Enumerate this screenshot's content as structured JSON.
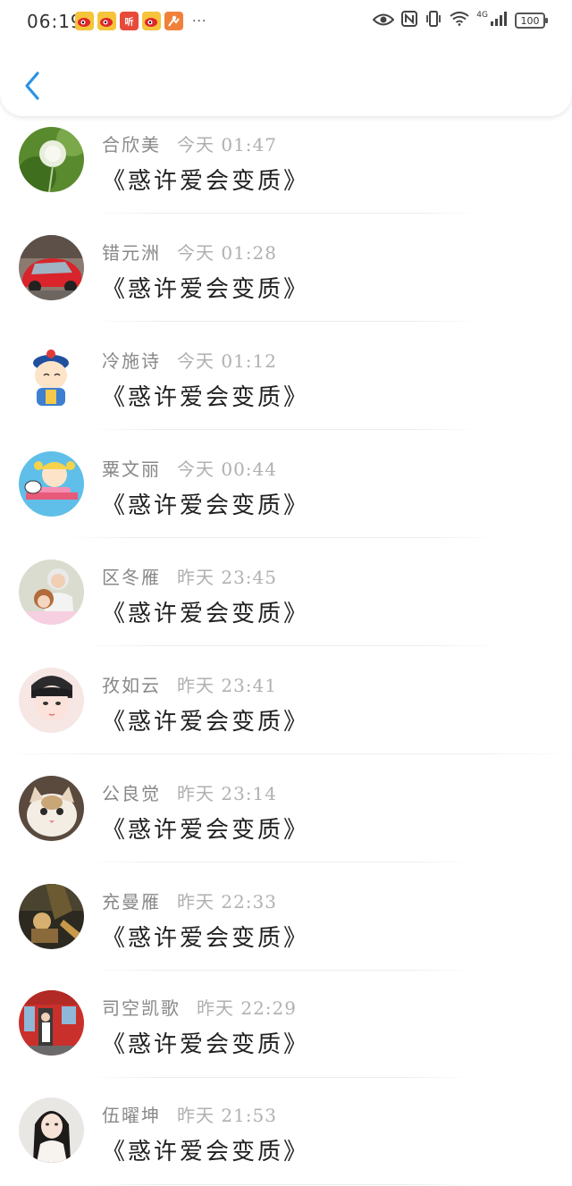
{
  "status_bar": {
    "time": "06:19",
    "notification_icons": [
      "weibo-icon",
      "weibo-icon",
      "ting-icon",
      "weibo-icon",
      "ka-icon"
    ],
    "ting_label": "听",
    "more": "···",
    "network": "4G",
    "battery": "100"
  },
  "header": {
    "back_icon": "chevron-left-icon",
    "accent_color": "#2a93e8"
  },
  "comments": [
    {
      "name": "合欣美",
      "time": "今天 01:47",
      "message": "《惑许爱会变质》",
      "avatar": "dandelion-avatar"
    },
    {
      "name": "错元洲",
      "time": "今天 01:28",
      "message": "《惑许爱会变质》",
      "avatar": "red-car-avatar"
    },
    {
      "name": "冷施诗",
      "time": "今天 01:12",
      "message": "《惑许爱会变质》",
      "avatar": "cartoon-qing-official-avatar"
    },
    {
      "name": "粟文丽",
      "time": "今天 00:44",
      "message": "《惑许爱会变质》",
      "avatar": "cartoon-girl-avatar"
    },
    {
      "name": "区冬雁",
      "time": "昨天 23:45",
      "message": "《惑许爱会变质》",
      "avatar": "couple-photo-avatar"
    },
    {
      "name": "孜如云",
      "time": "昨天 23:41",
      "message": "《惑许爱会变质》",
      "avatar": "boy-portrait-avatar"
    },
    {
      "name": "公良觉",
      "time": "昨天 23:14",
      "message": "《惑许爱会变质》",
      "avatar": "white-cat-avatar"
    },
    {
      "name": "充曼雁",
      "time": "昨天 22:33",
      "message": "《惑许爱会变质》",
      "avatar": "dark-illustration-avatar"
    },
    {
      "name": "司空凯歌",
      "time": "昨天 22:29",
      "message": "《惑许爱会变质》",
      "avatar": "red-train-avatar"
    },
    {
      "name": "伍曜坤",
      "time": "昨天 21:53",
      "message": "《惑许爱会变质》",
      "avatar": "girl-portrait-avatar"
    }
  ]
}
